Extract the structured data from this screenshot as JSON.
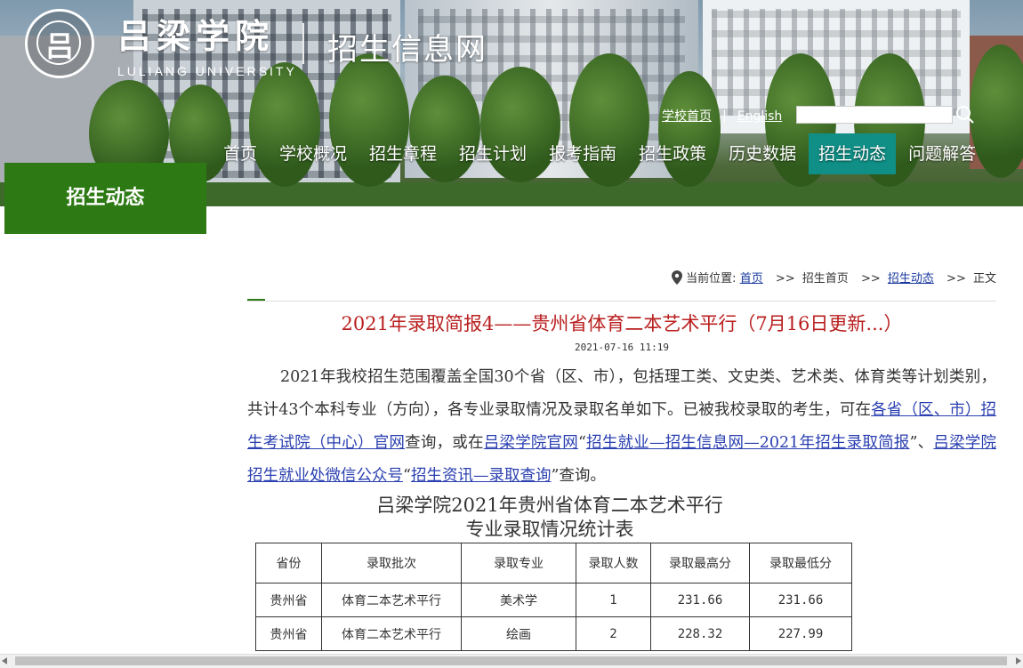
{
  "header": {
    "school_name": "吕梁学院",
    "school_name_en": "LULIANG UNIVERSITY",
    "site_title": "招生信息网",
    "emblem_glyph": "吕"
  },
  "toplinks": {
    "home": "学校首页",
    "separator": "|",
    "english": "English"
  },
  "search": {
    "placeholder": "",
    "value": ""
  },
  "nav": {
    "items": [
      "首页",
      "学校概况",
      "招生章程",
      "招生计划",
      "报考指南",
      "招生政策",
      "历史数据",
      "招生动态",
      "问题解答"
    ],
    "active": "招生动态"
  },
  "section": {
    "title": "招生动态"
  },
  "breadcrumb": {
    "label": "当前位置:",
    "home": "首页",
    "sep1": ">>",
    "level1": "招生首页",
    "sep2": ">>",
    "level2": "招生动态",
    "sep3": ">>",
    "current": "正文"
  },
  "article": {
    "title": "2021年录取简报4——贵州省体育二本艺术平行（7月16日更新...）",
    "date": "2021-07-16 11:19",
    "p1": "2021年我校招生范围覆盖全国30个省（区、市），包括理工类、文史类、艺术类、体育类等计划类别，共计43个本科专业（方向），各专业录取情况及录取名单如下。已被我校录取的考生，可在",
    "link1": "各省（区、市）招生考试院（中心）官网",
    "p2": "查询，或在",
    "link2": "吕梁学院官网",
    "p3": "“",
    "link3": "招生就业—招生信息网—2021年招生录取简报",
    "p4": "”、",
    "link4": "吕梁学院招生就业处微信公众号",
    "p5": "“",
    "link5": "招生资讯—录取查询",
    "p6": "”查询。"
  },
  "table": {
    "title_line1": "吕梁学院2021年贵州省体育二本艺术平行",
    "title_line2": "专业录取情况统计表",
    "headers": [
      "省份",
      "录取批次",
      "录取专业",
      "录取人数",
      "录取最高分",
      "录取最低分"
    ],
    "rows": [
      [
        "贵州省",
        "体育二本艺术平行",
        "美术学",
        "1",
        "231.66",
        "231.66"
      ],
      [
        "贵州省",
        "体育二本艺术平行",
        "绘画",
        "2",
        "228.32",
        "227.99"
      ]
    ]
  },
  "colors": {
    "nav_active": "#0f8f86",
    "section_box": "#2d7a14",
    "title_red": "#b91f1f",
    "link_blue": "#2a3fb0"
  },
  "icons": [
    "search-icon",
    "location-pin-icon",
    "school-emblem-icon"
  ]
}
